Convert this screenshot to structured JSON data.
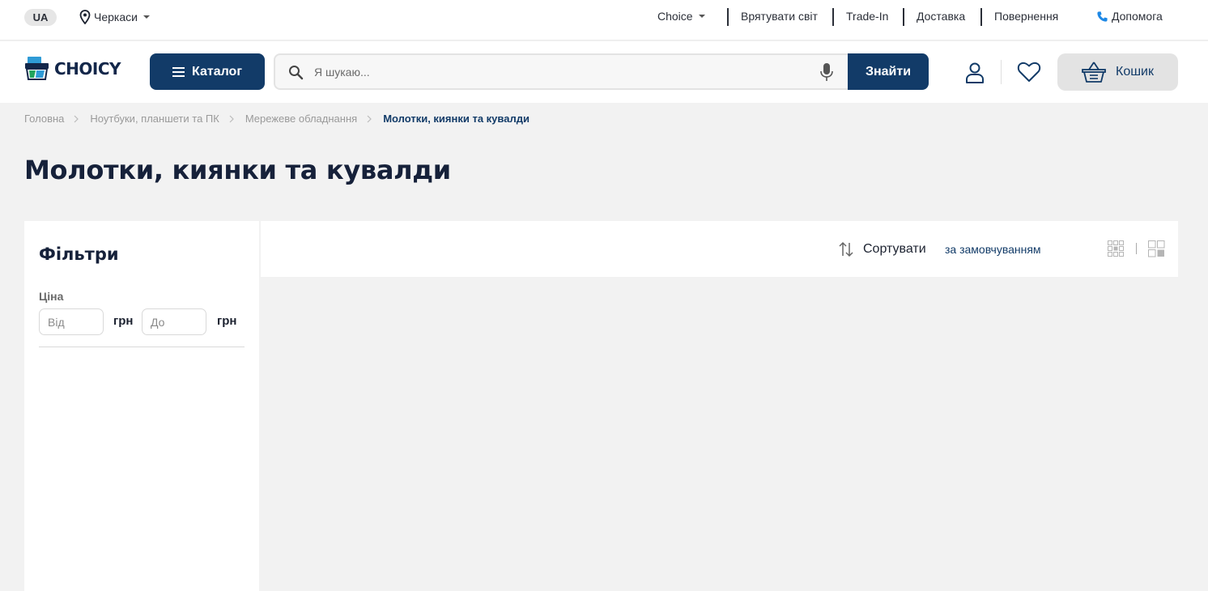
{
  "topbar": {
    "lang": "UA",
    "city": "Черкаси",
    "links": [
      "Choice",
      "Врятувати світ",
      "Trade-In",
      "Доставка",
      "Повернення"
    ],
    "help": "Допомога"
  },
  "header": {
    "logo": "CHOICY",
    "catalog_label": "Каталог",
    "search_placeholder": "Я шукаю...",
    "search_button": "Знайти",
    "cart_label": "Кошик"
  },
  "breadcrumbs": [
    "Головна",
    "Ноутбуки, планшети та ПК",
    "Мережеве обладнання",
    "Молотки, киянки та кувалди"
  ],
  "page_title": "Молотки, киянки та кувалди",
  "filters": {
    "title": "Фільтри",
    "price_label": "Ціна",
    "from_placeholder": "Від",
    "to_placeholder": "До",
    "currency": "грн"
  },
  "sort": {
    "label": "Сортувати",
    "value": "за замовчуванням"
  },
  "colors": {
    "brand": "#123b68",
    "background": "#f2f2f2",
    "phone_icon": "#1e88e5"
  },
  "icons": [
    "location-pin-icon",
    "phone-icon",
    "menu-icon",
    "search-icon",
    "microphone-icon",
    "user-icon",
    "heart-icon",
    "basket-icon",
    "chevron-right-icon",
    "sort-icon",
    "grid-small-icon",
    "grid-large-icon"
  ]
}
